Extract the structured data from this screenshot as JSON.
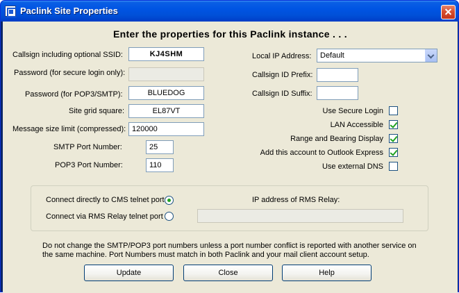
{
  "window": {
    "title": "Paclink Site Properties"
  },
  "heading": "Enter the properties for this Paclink instance . . .",
  "left": {
    "callsign": {
      "label": "Callsign including optional SSID:",
      "value": "KJ4SHM"
    },
    "password_secure": {
      "label": "Password (for secure login only):",
      "value": ""
    },
    "password_pop3": {
      "label": "Password (for POP3/SMTP):",
      "value": "BLUEDOG"
    },
    "grid_square": {
      "label": "Site grid square:",
      "value": "EL87VT"
    },
    "message_size": {
      "label": "Message size limit (compressed):",
      "value": "120000"
    },
    "smtp_port": {
      "label": "SMTP Port Number:",
      "value": "25"
    },
    "pop3_port": {
      "label": "POP3 Port Number:",
      "value": "110"
    }
  },
  "right": {
    "local_ip": {
      "label": "Local IP Address:",
      "value": "Default"
    },
    "callsign_prefix": {
      "label": "Callsign ID Prefix:",
      "value": ""
    },
    "callsign_suffix": {
      "label": "Callsign ID Suffix:",
      "value": ""
    },
    "checkboxes": [
      {
        "label": "Use Secure Login",
        "checked": false
      },
      {
        "label": "LAN Accessible",
        "checked": true
      },
      {
        "label": "Range and Bearing Display",
        "checked": true
      },
      {
        "label": "Add this account to Outlook Express",
        "checked": true
      },
      {
        "label": "Use external DNS",
        "checked": false
      }
    ]
  },
  "connection": {
    "direct_label": "Connect directly to CMS telnet port",
    "relay_label": "Connect via RMS Relay telnet port",
    "selected": "direct",
    "relay_ip_label": "IP address of RMS Relay:",
    "relay_ip_value": ""
  },
  "note": "Do not change the SMTP/POP3  port numbers unless a port number conflict is reported with another service on the same machine.  Port Numbers must match in both Paclink and your mail client account setup.",
  "buttons": {
    "update": "Update",
    "close": "Close",
    "help": "Help"
  }
}
